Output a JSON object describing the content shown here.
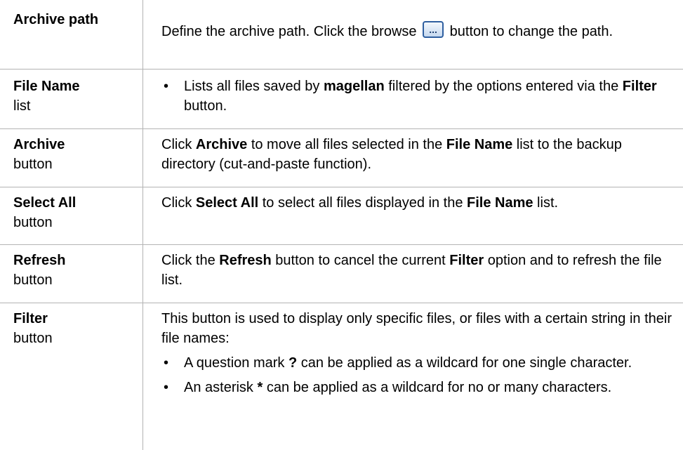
{
  "rows": [
    {
      "label": "Archive path",
      "desc_pre": "Define the archive path. Click the browse ",
      "browse_icon": "...",
      "desc_post": " button to change the path."
    },
    {
      "label_bold": "File Name",
      "label_rest": "list",
      "bullet": "•",
      "t1": "Lists all files saved by ",
      "b1": "magellan",
      "t2": " filtered by the options entered via the ",
      "b2": "Filter",
      "t3": " button."
    },
    {
      "label_bold": "Archive",
      "label_rest": "button",
      "t1": "Click ",
      "b1": "Archive",
      "t2": " to move all files selected in the ",
      "b2": "File Name",
      "t3": " list to the backup directory (cut-and-paste function)."
    },
    {
      "label_bold": "Select All",
      "label_rest": "button",
      "t1": "Click ",
      "b1": "Select All",
      "t2": " to select all files displayed in the ",
      "b2": "File Name",
      "t3": " list."
    },
    {
      "label_bold": "Refresh",
      "label_rest": "button",
      "t1": "Click the ",
      "b1": "Refresh",
      "t2": " button to cancel the current ",
      "b2": "Filter",
      "t3": " option and to refresh the file list."
    },
    {
      "label_bold": "Filter",
      "label_rest": "button",
      "intro": "This button is used to display only specific files, or files with a certain string in their file names:",
      "bullets": [
        {
          "t1": "A question mark ",
          "b1": "?",
          "t2": " can be applied as a wildcard for one single character."
        },
        {
          "t1": "An asterisk ",
          "b1": "*",
          "t2": " can be applied as a wildcard for no or many characters."
        }
      ]
    }
  ],
  "colors": {
    "rule": "#b3b3b3",
    "icon_border": "#2f5fa0"
  }
}
